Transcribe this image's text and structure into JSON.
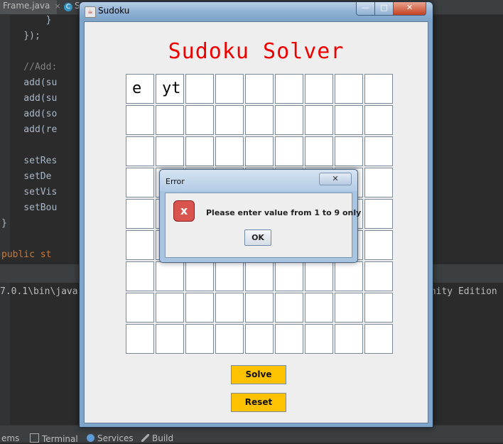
{
  "ide": {
    "tabs": [
      {
        "label": "Frame.java",
        "close": "×"
      },
      {
        "label": "S",
        "icon": "C"
      }
    ],
    "code_lines": [
      {
        "text": "        }",
        "cls": ""
      },
      {
        "text": "    });",
        "cls": ""
      },
      {
        "text": "",
        "cls": ""
      },
      {
        "text": "    //Add:",
        "cls": "comment"
      },
      {
        "text": "    add(su",
        "cls": ""
      },
      {
        "text": "    add(su",
        "cls": ""
      },
      {
        "text": "    add(so",
        "cls": ""
      },
      {
        "text": "    add(re",
        "cls": ""
      },
      {
        "text": "",
        "cls": ""
      },
      {
        "text": "    setRes",
        "cls": ""
      },
      {
        "text": "    setDe",
        "cls": ""
      },
      {
        "text": "    setVis",
        "cls": ""
      },
      {
        "text": "    setBou",
        "cls": ""
      },
      {
        "text": "}",
        "cls": ""
      },
      {
        "text": "",
        "cls": ""
      },
      {
        "text": "public st",
        "cls": "kw"
      }
    ],
    "console_left": "7.0.1\\bin\\java",
    "console_right": "unity Edition",
    "bottom_tabs": [
      {
        "label": "ems"
      },
      {
        "label": "Terminal"
      },
      {
        "label": "Services"
      },
      {
        "label": "Build"
      }
    ]
  },
  "window": {
    "title": "Sudoku",
    "minimize_glyph": "—",
    "maximize_glyph": "□",
    "close_glyph": "✕",
    "heading": "Sudoku Solver",
    "grid_values": [
      [
        "e",
        "yt",
        "",
        "",
        "",
        "",
        "",
        "",
        ""
      ],
      [
        "",
        "",
        "",
        "",
        "",
        "",
        "",
        "",
        ""
      ],
      [
        "",
        "",
        "",
        "",
        "",
        "",
        "",
        "",
        ""
      ],
      [
        "",
        "",
        "",
        "",
        "",
        "",
        "",
        "",
        ""
      ],
      [
        "",
        "",
        "",
        "",
        "",
        "",
        "",
        "",
        ""
      ],
      [
        "",
        "",
        "",
        "",
        "",
        "",
        "",
        "",
        ""
      ],
      [
        "",
        "",
        "",
        "",
        "",
        "",
        "",
        "",
        ""
      ],
      [
        "",
        "",
        "",
        "",
        "",
        "",
        "",
        "",
        ""
      ],
      [
        "",
        "",
        "",
        "",
        "",
        "",
        "",
        "",
        ""
      ]
    ],
    "solve_label": "Solve",
    "reset_label": "Reset"
  },
  "dialog": {
    "title": "Error",
    "close_glyph": "✕",
    "message": "Please enter value from 1 to 9 only",
    "ok_label": "OK",
    "icon_glyph": "x"
  },
  "colors": {
    "heading": "#ee0000",
    "button": "#ffc200"
  }
}
